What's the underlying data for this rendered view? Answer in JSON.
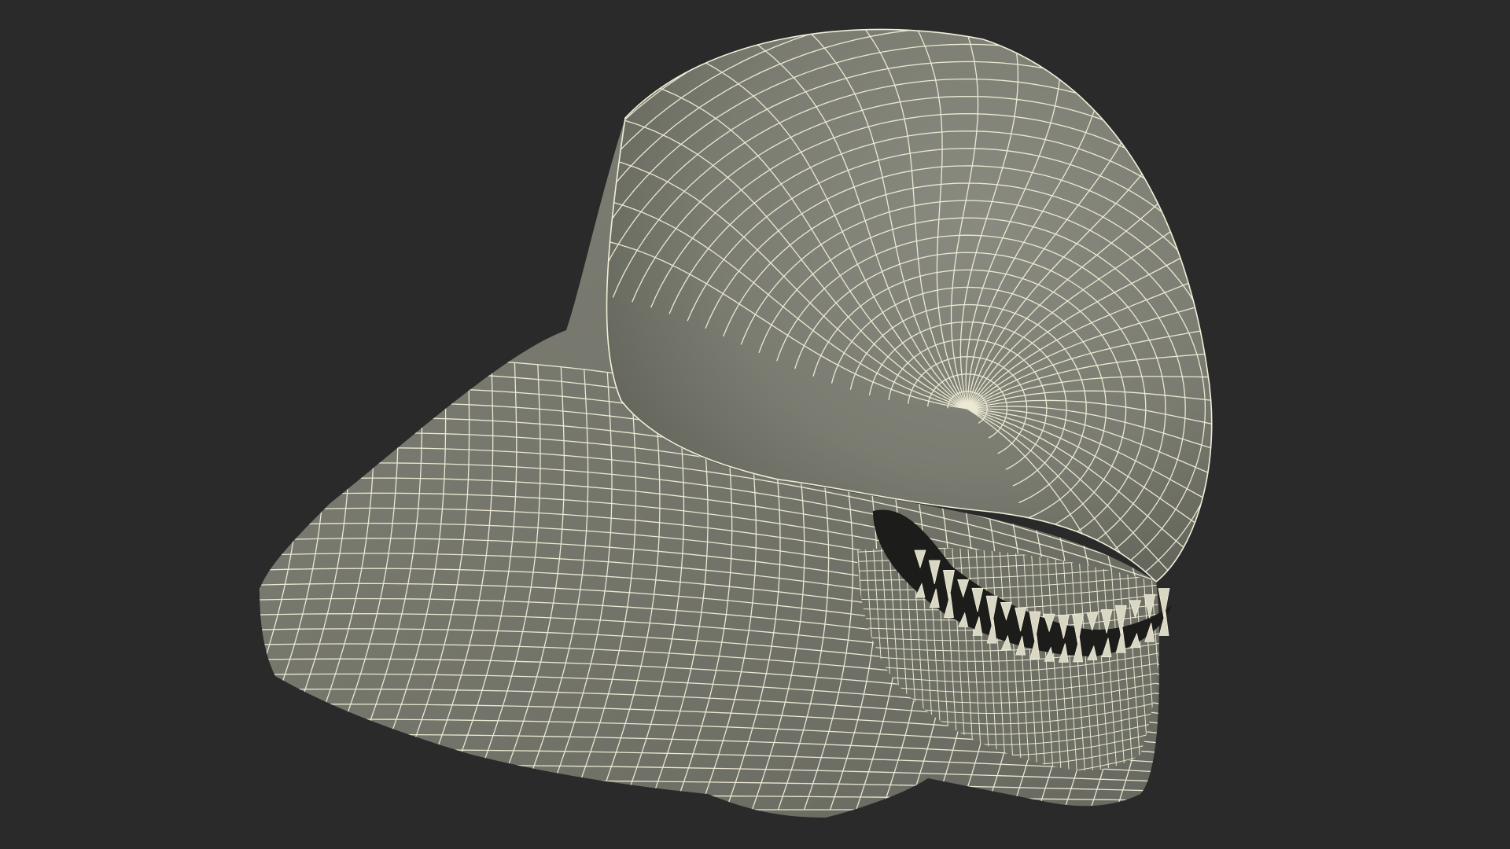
{
  "scene": {
    "background_color": "#2a2a2a",
    "surface_color": "#7b7c71",
    "surface_shadow_color": "#5f6057",
    "wire_color": "#f2efd9",
    "cavity_color": "#1c1c1a"
  }
}
